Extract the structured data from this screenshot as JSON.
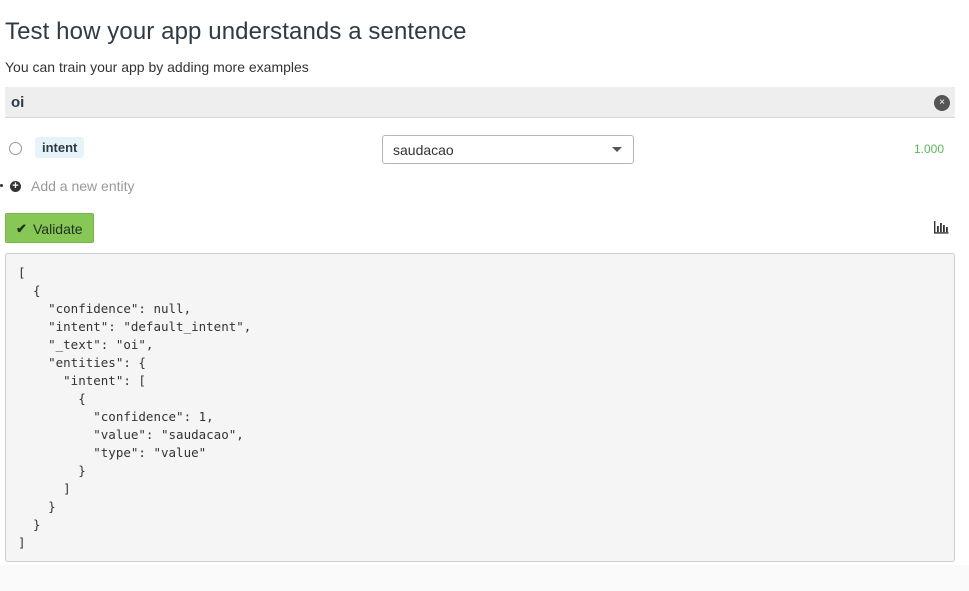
{
  "header": {
    "title": "Test how your app understands a sentence",
    "subtitle": "You can train your app by adding more examples"
  },
  "sentence": {
    "value": "oi",
    "clear_icon": "×"
  },
  "entity_row": {
    "tag": "intent",
    "selected_value": "saudacao",
    "confidence": "1.000",
    "confidence_color": "#5cb85c"
  },
  "add_entity": {
    "label": "Add a new entity",
    "icon": "plus-circle-icon"
  },
  "validate": {
    "label": "Validate",
    "icon": "✔",
    "color": "#86c756"
  },
  "chart_icon": "bar-chart-icon",
  "json_output": "[\n  {\n    \"confidence\": null,\n    \"intent\": \"default_intent\",\n    \"_text\": \"oi\",\n    \"entities\": {\n      \"intent\": [\n        {\n          \"confidence\": 1,\n          \"value\": \"saudacao\",\n          \"type\": \"value\"\n        }\n      ]\n    }\n  }\n]"
}
